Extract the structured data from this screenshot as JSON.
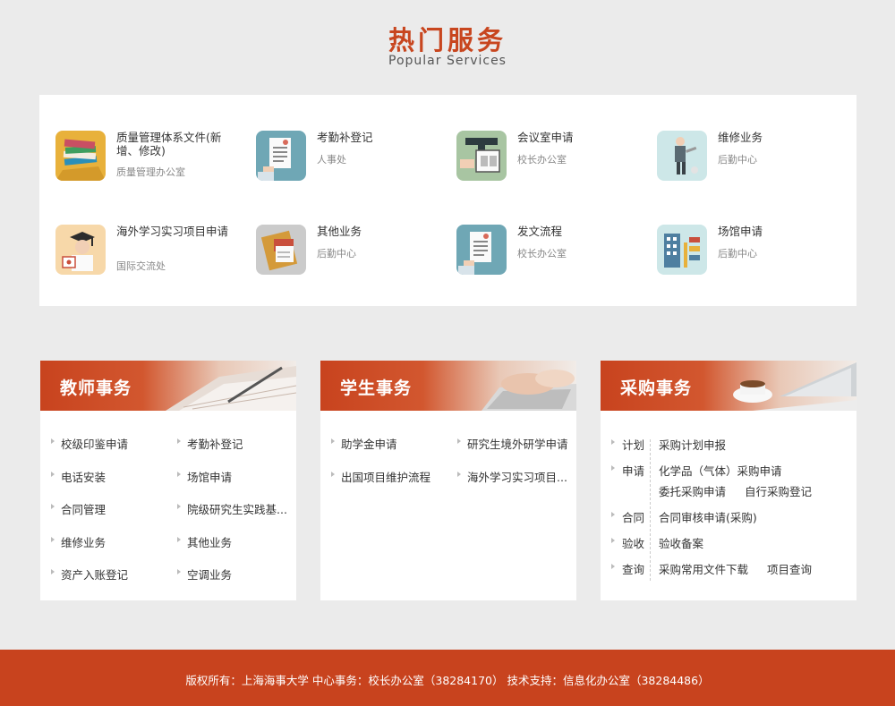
{
  "header": {
    "title_zh": "热门服务",
    "title_en": "Popular Services"
  },
  "services": [
    {
      "name": "质量管理体系文件(新增、修改)",
      "dept": "质量管理办公室",
      "icon": "books-icon"
    },
    {
      "name": "考勤补登记",
      "dept": "人事处",
      "icon": "document-icon"
    },
    {
      "name": "会议室申请",
      "dept": "校长办公室",
      "icon": "projector-icon"
    },
    {
      "name": "维修业务",
      "dept": "后勤中心",
      "icon": "repairman-icon"
    },
    {
      "name": "海外学习实习项目申请",
      "dept": "国际交流处",
      "icon": "graduate-icon"
    },
    {
      "name": "其他业务",
      "dept": "后勤中心",
      "icon": "notebook-icon"
    },
    {
      "name": "发文流程",
      "dept": "校长办公室",
      "icon": "document-icon"
    },
    {
      "name": "场馆申请",
      "dept": "后勤中心",
      "icon": "building-icon"
    }
  ],
  "teacher": {
    "title": "教师事务",
    "links": [
      "校级印鉴申请",
      "考勤补登记",
      "电话安装",
      "场馆申请",
      "合同管理",
      "院级研究生实践基...",
      "维修业务",
      "其他业务",
      "资产入账登记",
      "空调业务"
    ]
  },
  "student": {
    "title": "学生事务",
    "links": [
      "助学金申请",
      "研究生境外研学申请",
      "出国项目维护流程",
      "海外学习实习项目..."
    ]
  },
  "purchase": {
    "title": "采购事务",
    "rows": [
      {
        "label": "计划",
        "items": [
          "采购计划申报"
        ]
      },
      {
        "label": "申请",
        "items": [
          "化学品（气体）采购申请",
          "委托采购申请",
          "自行采购登记"
        ]
      },
      {
        "label": "合同",
        "items": [
          "合同审核申请(采购)"
        ]
      },
      {
        "label": "验收",
        "items": [
          "验收备案"
        ]
      },
      {
        "label": "查询",
        "items": [
          "采购常用文件下载",
          "项目查询"
        ]
      }
    ]
  },
  "footer": {
    "text": "版权所有：上海海事大学  中心事务：校长办公室（38284170）  技术支持：信息化办公室（38284486）"
  },
  "colors": {
    "accent": "#c8431e",
    "background": "#ebebeb",
    "panel": "#ffffff"
  }
}
